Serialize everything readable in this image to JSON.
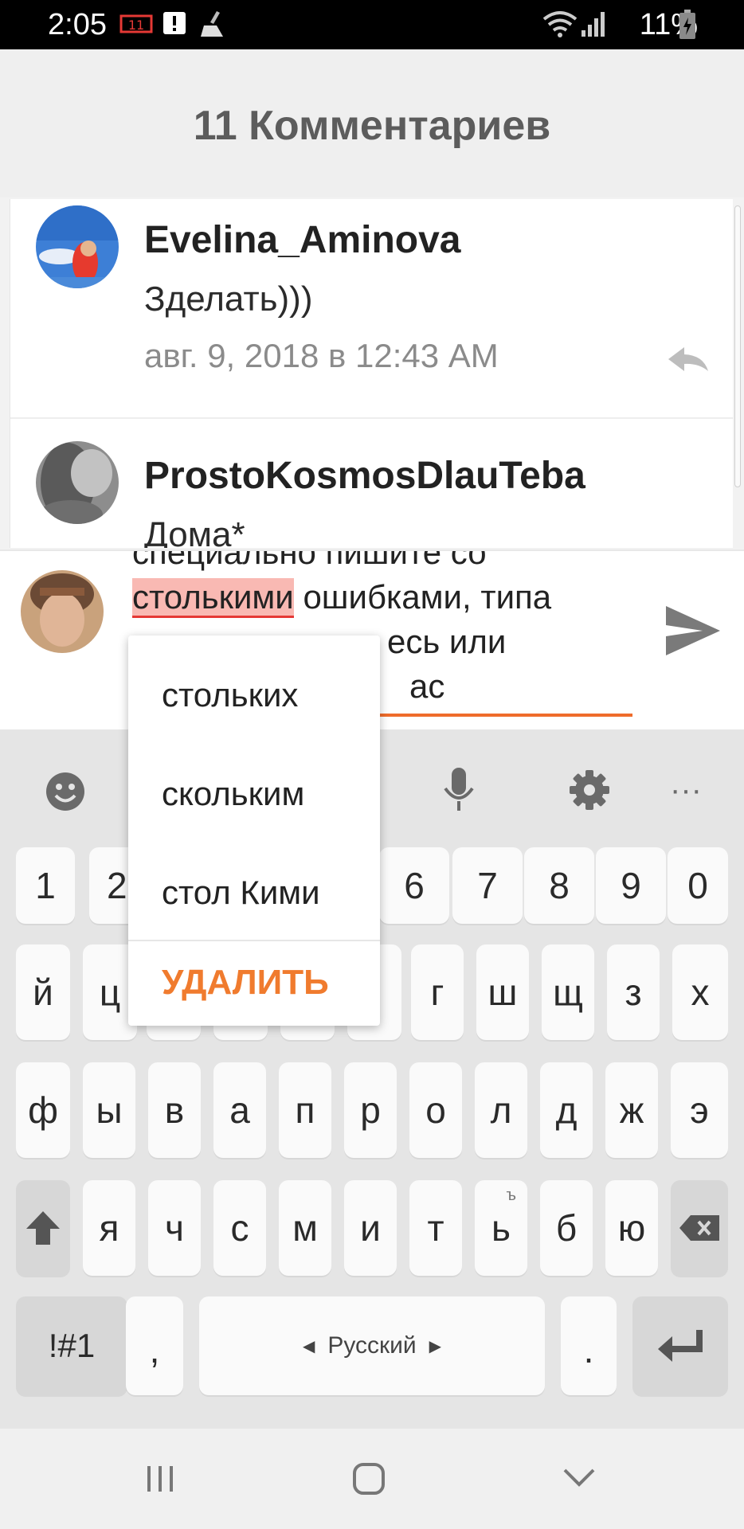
{
  "status_bar": {
    "time": "2:05",
    "battery": "11%"
  },
  "header": {
    "title": "11 Комментариев"
  },
  "comments": [
    {
      "author": "Evelina_Aminova",
      "text": "Зделать)))",
      "date": "авг. 9, 2018 в 12:43 AM"
    },
    {
      "author": "ProstoKosmosDlauTeba",
      "text": "Дома*"
    }
  ],
  "composer": {
    "lines": [
      "специально пишите со",
      "ошибками, типа",
      "есь или",
      "ас"
    ],
    "highlighted_word": "столькими",
    "underline_color": "#ef6c2b"
  },
  "suggestions": {
    "items": [
      "стольких",
      "скольким",
      "стол Кими"
    ],
    "delete_label": "УДАЛИТЬ"
  },
  "keyboard": {
    "toolbar_more": "···",
    "numbers": [
      "1",
      "2",
      "6",
      "7",
      "8",
      "9",
      "0"
    ],
    "row1": [
      "й",
      "ц",
      "г",
      "ш",
      "щ",
      "з",
      "х"
    ],
    "row2": [
      "ф",
      "ы",
      "в",
      "а",
      "п",
      "р",
      "о",
      "л",
      "д",
      "ж",
      "э"
    ],
    "row3": [
      "я",
      "ч",
      "с",
      "м",
      "и",
      "т",
      "ь",
      "б",
      "ю"
    ],
    "row3_hint": "ъ",
    "symbols": "!#1",
    "comma": ",",
    "language": "Русский",
    "period": "."
  },
  "colors": {
    "accent": "#ef6c2b",
    "misspelling": "#f9b9b3"
  }
}
